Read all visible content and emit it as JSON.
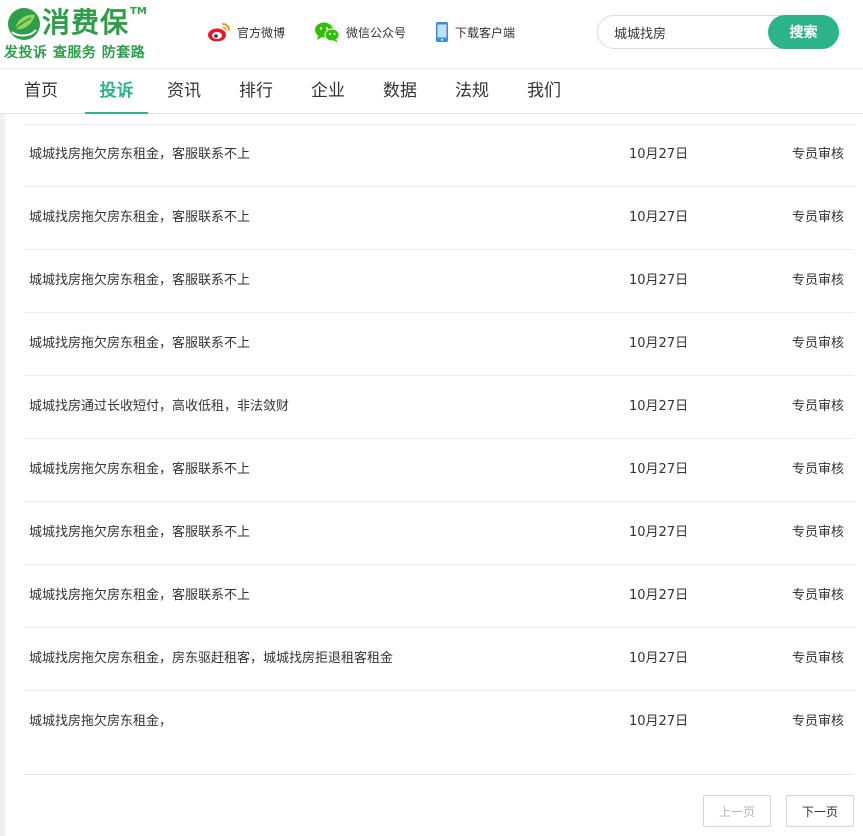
{
  "header": {
    "logo": {
      "name": "消费保",
      "tm": "TM",
      "slogan": "发投诉 查服务 防套路"
    },
    "links": {
      "weibo": "官方微博",
      "wechat": "微信公众号",
      "app": "下载客户端"
    },
    "search": {
      "value": "城城找房",
      "button": "搜索"
    }
  },
  "nav": {
    "items": [
      "首页",
      "投诉",
      "资讯",
      "排行",
      "企业",
      "数据",
      "法规",
      "我们"
    ],
    "active": "投诉"
  },
  "complaints": [
    {
      "title": "城城找房拖欠房东租金，客服联系不上",
      "date": "10月27日",
      "status": "专员审核"
    },
    {
      "title": "城城找房拖欠房东租金，客服联系不上",
      "date": "10月27日",
      "status": "专员审核"
    },
    {
      "title": "城城找房拖欠房东租金，客服联系不上",
      "date": "10月27日",
      "status": "专员审核"
    },
    {
      "title": "城城找房拖欠房东租金，客服联系不上",
      "date": "10月27日",
      "status": "专员审核"
    },
    {
      "title": "城城找房通过长收短付，高收低租，非法敛财",
      "date": "10月27日",
      "status": "专员审核"
    },
    {
      "title": "城城找房拖欠房东租金，客服联系不上",
      "date": "10月27日",
      "status": "专员审核"
    },
    {
      "title": "城城找房拖欠房东租金，客服联系不上",
      "date": "10月27日",
      "status": "专员审核"
    },
    {
      "title": "城城找房拖欠房东租金，客服联系不上",
      "date": "10月27日",
      "status": "专员审核"
    },
    {
      "title": "城城找房拖欠房东租金，房东驱赶租客，城城找房拒退租客租金",
      "date": "10月27日",
      "status": "专员审核"
    },
    {
      "title": "城城找房拖欠房东租金，",
      "date": "10月27日",
      "status": "专员审核"
    }
  ],
  "pager": {
    "prev": "上一页",
    "next": "下一页"
  },
  "colors": {
    "brand_green": "#2d9e4a",
    "accent": "#2bb389",
    "weibo_red": "#e6162d",
    "wechat_green": "#2dc100",
    "phone_blue": "#3a8fd9"
  }
}
